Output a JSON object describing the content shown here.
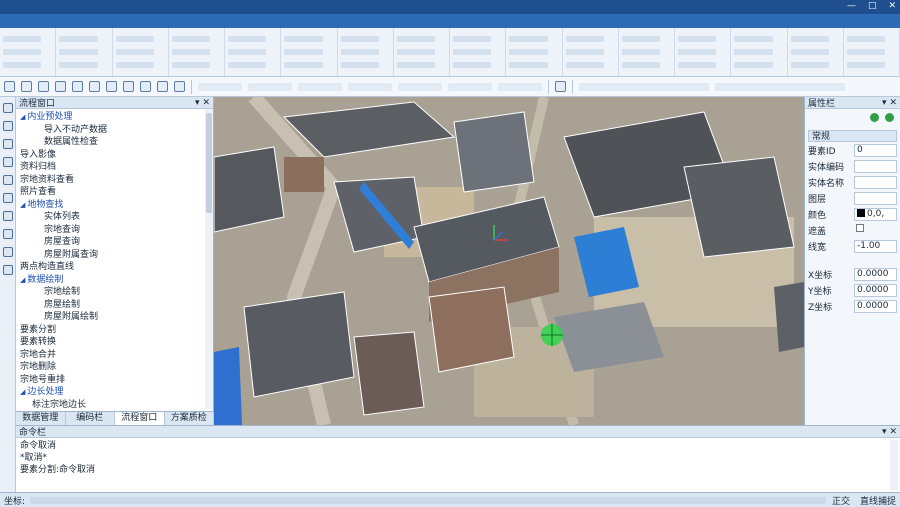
{
  "flow_panel": {
    "title": "流程窗口",
    "pin_icon": "pin-icon",
    "close_icon": "close-icon",
    "items": [
      {
        "level": 0,
        "section": true,
        "label": "内业预处理"
      },
      {
        "level": 1,
        "label": "导入不动产数据"
      },
      {
        "level": 1,
        "label": "数据属性检查"
      },
      {
        "level": 0,
        "label": "导入影像"
      },
      {
        "level": 0,
        "label": "资料归档"
      },
      {
        "level": 0,
        "label": "宗地资料查看"
      },
      {
        "level": 0,
        "label": "照片查看"
      },
      {
        "level": 0,
        "section": true,
        "label": "地物查找"
      },
      {
        "level": 1,
        "label": "实体列表"
      },
      {
        "level": 1,
        "label": "宗地查询"
      },
      {
        "level": 1,
        "label": "房屋查询"
      },
      {
        "level": 1,
        "label": "房屋附属查询"
      },
      {
        "level": 0,
        "label": "两点构造直线"
      },
      {
        "level": 0,
        "section": true,
        "label": "数据绘制"
      },
      {
        "level": 1,
        "label": "宗地绘制"
      },
      {
        "level": 1,
        "label": "房屋绘制"
      },
      {
        "level": 1,
        "label": "房屋附属绘制"
      },
      {
        "level": 0,
        "label": "要素分割"
      },
      {
        "level": 0,
        "label": "要素转换"
      },
      {
        "level": 0,
        "label": "宗地合并"
      },
      {
        "level": 0,
        "label": "宗地删除"
      },
      {
        "level": 0,
        "label": "宗地号重排"
      },
      {
        "level": 0,
        "section": true,
        "label": "边长处理"
      },
      {
        "level": 1,
        "sub": true,
        "label": "标注宗地边长"
      }
    ]
  },
  "bottom_tabs": [
    {
      "label": "数据管理",
      "active": false
    },
    {
      "label": "编码栏",
      "active": false
    },
    {
      "label": "流程窗口",
      "active": true
    },
    {
      "label": "方案质检",
      "active": false
    }
  ],
  "property_panel": {
    "title": "属性栏",
    "section": "常规",
    "fields": [
      {
        "label": "要素ID",
        "value": "0"
      },
      {
        "label": "实体编码",
        "value": ""
      },
      {
        "label": "实体名称",
        "value": ""
      },
      {
        "label": "图层",
        "value": ""
      },
      {
        "label": "颜色",
        "value": "0,0,",
        "swatch": "#000000"
      },
      {
        "label": "遮盖",
        "value": "",
        "checkbox": true
      },
      {
        "label": "线宽",
        "value": "-1.00"
      }
    ],
    "coords": [
      {
        "label": "X坐标",
        "value": "0.0000"
      },
      {
        "label": "Y坐标",
        "value": "0.0000"
      },
      {
        "label": "Z坐标",
        "value": "0.0000"
      }
    ]
  },
  "command_panel": {
    "title": "命令栏",
    "lines": [
      "命令取消",
      "*取消*",
      "要素分割:命令取消"
    ]
  },
  "status_bar": {
    "left": "坐标:",
    "right": [
      {
        "label": "正交",
        "active": false
      },
      {
        "label": "直线捕捉",
        "active": false
      }
    ]
  },
  "icons": {
    "left_toolbar": [
      "undo-icon",
      "redo-icon",
      "select-icon",
      "zoom-in-icon",
      "zoom-out-icon",
      "measure-icon",
      "draw-line-icon",
      "draw-polygon-icon",
      "layer-icon",
      "erase-icon"
    ],
    "green_buttons": [
      "add-icon",
      "refresh-icon"
    ]
  },
  "colors": {
    "ribbon": "#2c6bb5",
    "titlebar": "#1f4f8f",
    "section_text": "#1d4fb0",
    "marker": "#2fd34a",
    "building_outline": "#ffffff"
  }
}
